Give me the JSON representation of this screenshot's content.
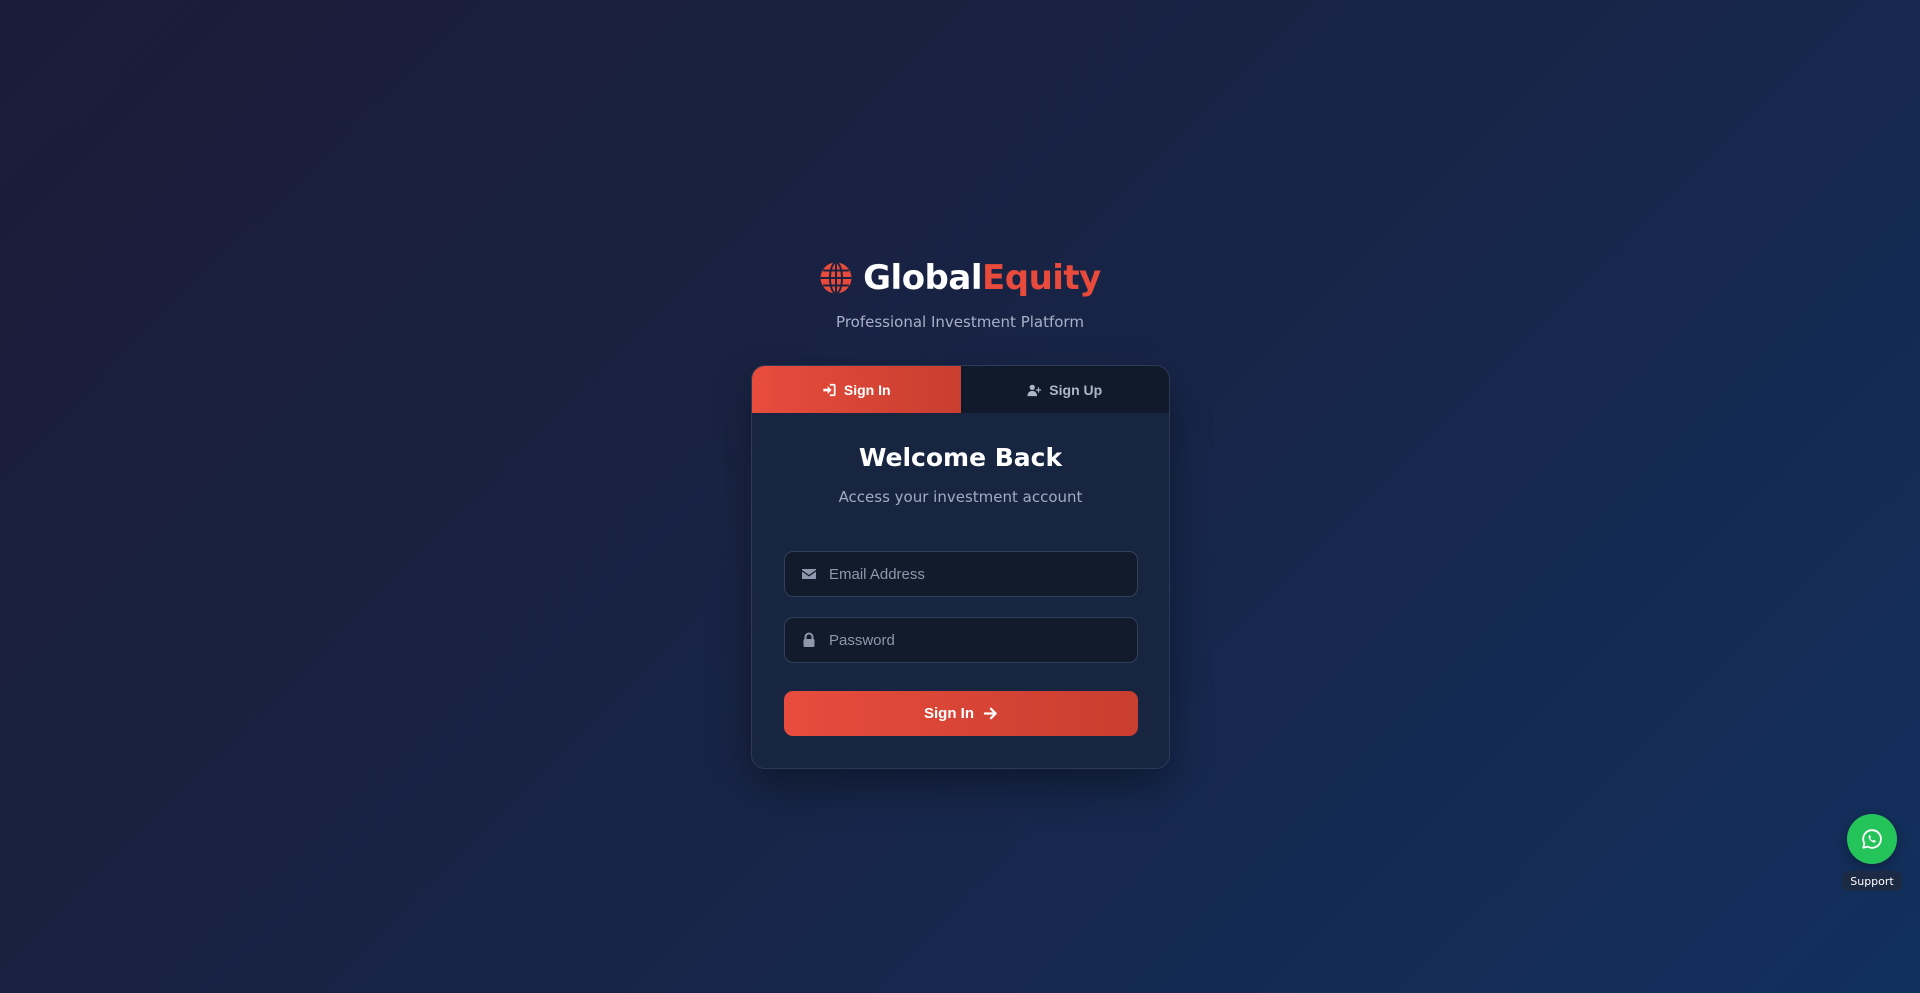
{
  "brand": {
    "name_part1": "Global",
    "name_part2": "Equity",
    "tagline": "Professional Investment Platform",
    "icon": "globe-icon",
    "accent_color": "#e84b3c"
  },
  "tabs": [
    {
      "label": "Sign In",
      "icon": "sign-in-icon",
      "active": true
    },
    {
      "label": "Sign Up",
      "icon": "user-plus-icon",
      "active": false
    }
  ],
  "form": {
    "heading": "Welcome Back",
    "subheading": "Access your investment account",
    "email_placeholder": "Email Address",
    "email_value": "",
    "email_icon": "envelope-icon",
    "password_placeholder": "Password",
    "password_value": "",
    "password_icon": "lock-icon",
    "submit_label": "Sign In",
    "submit_icon": "arrow-right-icon"
  },
  "support": {
    "label": "Support",
    "icon": "whatsapp-icon",
    "color": "#25c45b"
  }
}
